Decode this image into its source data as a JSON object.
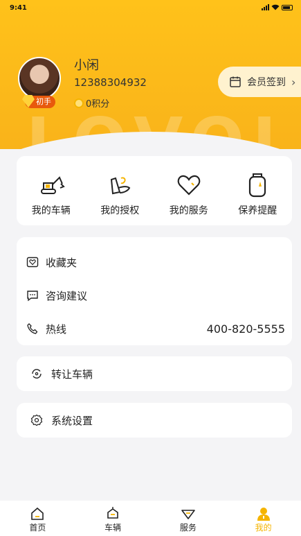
{
  "status_bar": {
    "time": "9:41"
  },
  "header": {
    "watermark": "LOVOL"
  },
  "profile": {
    "name": "小闲",
    "phone": "12388304932",
    "badge": "初手",
    "points": "0积分"
  },
  "signin": {
    "label": "会员签到"
  },
  "quick_actions": [
    {
      "label": "我的车辆",
      "icon": "excavator-icon"
    },
    {
      "label": "我的授权",
      "icon": "hand-card-icon"
    },
    {
      "label": "我的服务",
      "icon": "heart-icon"
    },
    {
      "label": "保养提醒",
      "icon": "oil-can-icon"
    }
  ],
  "menu": {
    "favorites": "收藏夹",
    "feedback": "咨询建议",
    "hotline": "热线",
    "hotline_number": "400-820-5555"
  },
  "transfer": {
    "label": "转让车辆"
  },
  "settings": {
    "label": "系统设置"
  },
  "tabbar": [
    {
      "label": "首页",
      "icon": "home-icon"
    },
    {
      "label": "车辆",
      "icon": "vehicle-icon"
    },
    {
      "label": "服务",
      "icon": "service-icon"
    },
    {
      "label": "我的",
      "icon": "person-icon",
      "active": true
    }
  ],
  "colors": {
    "accent": "#f5b400",
    "header": "#ffc21a",
    "badge": "#e8590c"
  }
}
